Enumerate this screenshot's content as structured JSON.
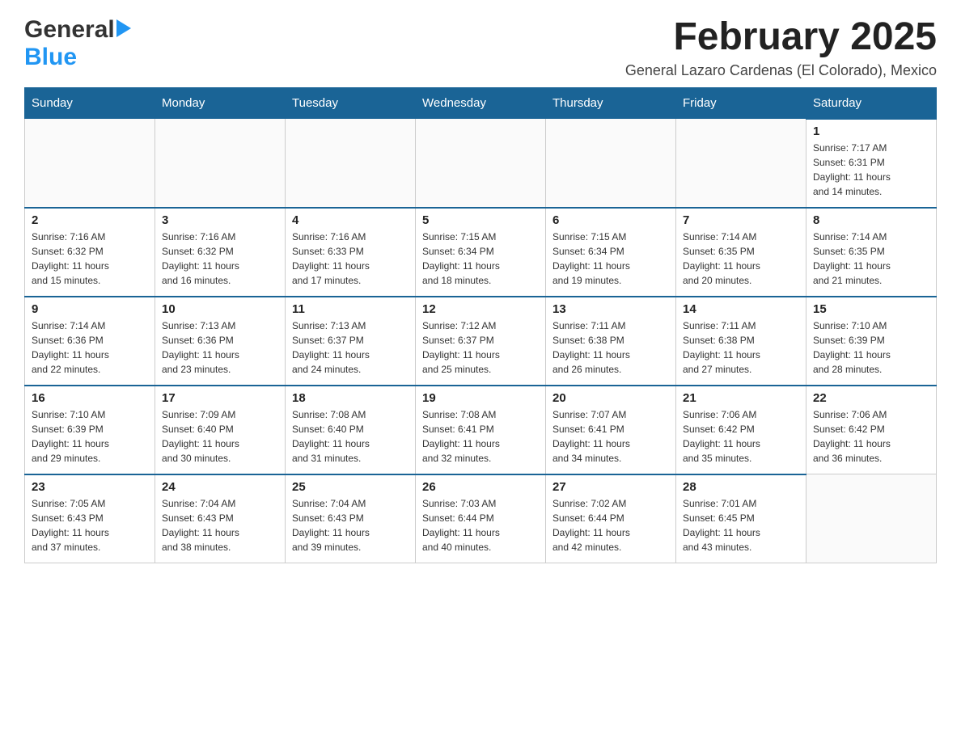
{
  "header": {
    "logo_general": "General",
    "logo_blue": "Blue",
    "month_title": "February 2025",
    "subtitle": "General Lazaro Cardenas (El Colorado), Mexico"
  },
  "days_of_week": [
    "Sunday",
    "Monday",
    "Tuesday",
    "Wednesday",
    "Thursday",
    "Friday",
    "Saturday"
  ],
  "weeks": [
    [
      {
        "day": "",
        "info": ""
      },
      {
        "day": "",
        "info": ""
      },
      {
        "day": "",
        "info": ""
      },
      {
        "day": "",
        "info": ""
      },
      {
        "day": "",
        "info": ""
      },
      {
        "day": "",
        "info": ""
      },
      {
        "day": "1",
        "info": "Sunrise: 7:17 AM\nSunset: 6:31 PM\nDaylight: 11 hours\nand 14 minutes."
      }
    ],
    [
      {
        "day": "2",
        "info": "Sunrise: 7:16 AM\nSunset: 6:32 PM\nDaylight: 11 hours\nand 15 minutes."
      },
      {
        "day": "3",
        "info": "Sunrise: 7:16 AM\nSunset: 6:32 PM\nDaylight: 11 hours\nand 16 minutes."
      },
      {
        "day": "4",
        "info": "Sunrise: 7:16 AM\nSunset: 6:33 PM\nDaylight: 11 hours\nand 17 minutes."
      },
      {
        "day": "5",
        "info": "Sunrise: 7:15 AM\nSunset: 6:34 PM\nDaylight: 11 hours\nand 18 minutes."
      },
      {
        "day": "6",
        "info": "Sunrise: 7:15 AM\nSunset: 6:34 PM\nDaylight: 11 hours\nand 19 minutes."
      },
      {
        "day": "7",
        "info": "Sunrise: 7:14 AM\nSunset: 6:35 PM\nDaylight: 11 hours\nand 20 minutes."
      },
      {
        "day": "8",
        "info": "Sunrise: 7:14 AM\nSunset: 6:35 PM\nDaylight: 11 hours\nand 21 minutes."
      }
    ],
    [
      {
        "day": "9",
        "info": "Sunrise: 7:14 AM\nSunset: 6:36 PM\nDaylight: 11 hours\nand 22 minutes."
      },
      {
        "day": "10",
        "info": "Sunrise: 7:13 AM\nSunset: 6:36 PM\nDaylight: 11 hours\nand 23 minutes."
      },
      {
        "day": "11",
        "info": "Sunrise: 7:13 AM\nSunset: 6:37 PM\nDaylight: 11 hours\nand 24 minutes."
      },
      {
        "day": "12",
        "info": "Sunrise: 7:12 AM\nSunset: 6:37 PM\nDaylight: 11 hours\nand 25 minutes."
      },
      {
        "day": "13",
        "info": "Sunrise: 7:11 AM\nSunset: 6:38 PM\nDaylight: 11 hours\nand 26 minutes."
      },
      {
        "day": "14",
        "info": "Sunrise: 7:11 AM\nSunset: 6:38 PM\nDaylight: 11 hours\nand 27 minutes."
      },
      {
        "day": "15",
        "info": "Sunrise: 7:10 AM\nSunset: 6:39 PM\nDaylight: 11 hours\nand 28 minutes."
      }
    ],
    [
      {
        "day": "16",
        "info": "Sunrise: 7:10 AM\nSunset: 6:39 PM\nDaylight: 11 hours\nand 29 minutes."
      },
      {
        "day": "17",
        "info": "Sunrise: 7:09 AM\nSunset: 6:40 PM\nDaylight: 11 hours\nand 30 minutes."
      },
      {
        "day": "18",
        "info": "Sunrise: 7:08 AM\nSunset: 6:40 PM\nDaylight: 11 hours\nand 31 minutes."
      },
      {
        "day": "19",
        "info": "Sunrise: 7:08 AM\nSunset: 6:41 PM\nDaylight: 11 hours\nand 32 minutes."
      },
      {
        "day": "20",
        "info": "Sunrise: 7:07 AM\nSunset: 6:41 PM\nDaylight: 11 hours\nand 34 minutes."
      },
      {
        "day": "21",
        "info": "Sunrise: 7:06 AM\nSunset: 6:42 PM\nDaylight: 11 hours\nand 35 minutes."
      },
      {
        "day": "22",
        "info": "Sunrise: 7:06 AM\nSunset: 6:42 PM\nDaylight: 11 hours\nand 36 minutes."
      }
    ],
    [
      {
        "day": "23",
        "info": "Sunrise: 7:05 AM\nSunset: 6:43 PM\nDaylight: 11 hours\nand 37 minutes."
      },
      {
        "day": "24",
        "info": "Sunrise: 7:04 AM\nSunset: 6:43 PM\nDaylight: 11 hours\nand 38 minutes."
      },
      {
        "day": "25",
        "info": "Sunrise: 7:04 AM\nSunset: 6:43 PM\nDaylight: 11 hours\nand 39 minutes."
      },
      {
        "day": "26",
        "info": "Sunrise: 7:03 AM\nSunset: 6:44 PM\nDaylight: 11 hours\nand 40 minutes."
      },
      {
        "day": "27",
        "info": "Sunrise: 7:02 AM\nSunset: 6:44 PM\nDaylight: 11 hours\nand 42 minutes."
      },
      {
        "day": "28",
        "info": "Sunrise: 7:01 AM\nSunset: 6:45 PM\nDaylight: 11 hours\nand 43 minutes."
      },
      {
        "day": "",
        "info": ""
      }
    ]
  ]
}
